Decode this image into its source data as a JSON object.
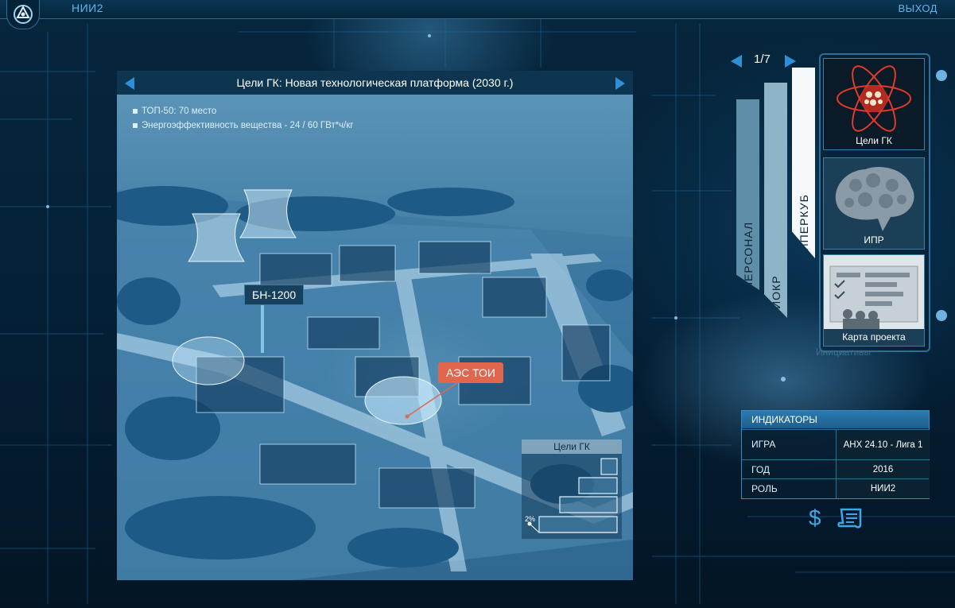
{
  "topbar": {
    "title": "НИИ2",
    "exit_label": "ВЫХОД"
  },
  "panel": {
    "title": "Цели ГК: Новая технологическая платформа (2030 г.)",
    "bullets": [
      "ТОП-50: 70 место",
      "Энергоэффективность вещества - 24 / 60 ГВт*ч/кг"
    ],
    "labels": {
      "bn": "БН-1200",
      "aes": "АЭС ТОИ"
    },
    "mini": {
      "title": "Цели ГК",
      "progress_text": "2%",
      "progress": 0.02
    }
  },
  "pager": {
    "text": "1/7"
  },
  "tabs": [
    {
      "label": "ПЕРСОНАЛ"
    },
    {
      "label": "НИОКР"
    },
    {
      "label": "ГИПЕРКУБ"
    }
  ],
  "cards": [
    {
      "label": "Цели ГК",
      "icon": "atom-icon"
    },
    {
      "label": "ИПР",
      "icon": "brain-icon"
    },
    {
      "label": "Карта проекта",
      "icon": "project-map-icon"
    }
  ],
  "ghost_text": {
    "a": "Инициативы"
  },
  "indicators": {
    "title": "ИНДИКАТОРЫ",
    "rows": [
      {
        "key": "ИГРА",
        "value": "АНХ 24.10 - Лига 1"
      },
      {
        "key": "ГОД",
        "value": "2016"
      },
      {
        "key": "РОЛЬ",
        "value": "НИИ2"
      }
    ]
  },
  "bottom_icons": {
    "money": "$"
  },
  "colors": {
    "accent": "#2f8fd6",
    "aes_label": "#e0674d",
    "panel_header": "#0d3550"
  }
}
